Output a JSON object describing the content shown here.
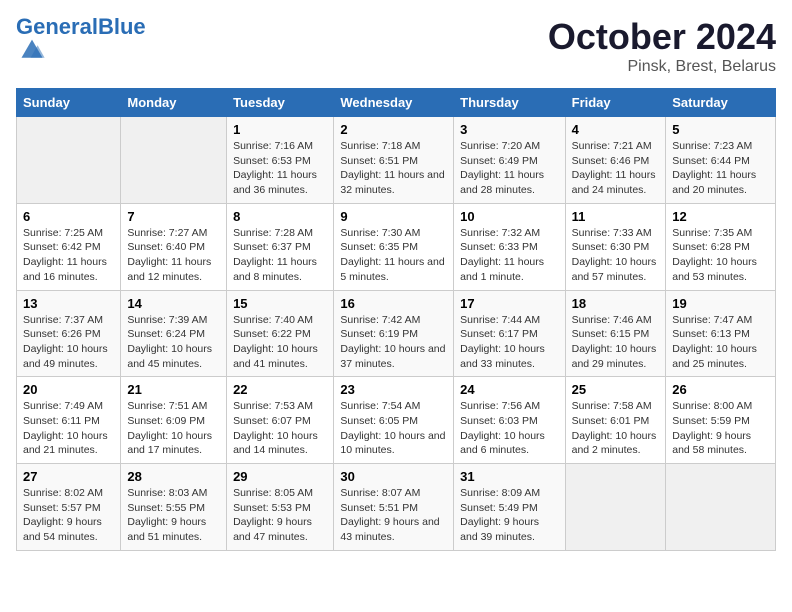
{
  "logo": {
    "text_general": "General",
    "text_blue": "Blue"
  },
  "title": "October 2024",
  "subtitle": "Pinsk, Brest, Belarus",
  "days_of_week": [
    "Sunday",
    "Monday",
    "Tuesday",
    "Wednesday",
    "Thursday",
    "Friday",
    "Saturday"
  ],
  "weeks": [
    [
      {
        "day": "",
        "info": ""
      },
      {
        "day": "",
        "info": ""
      },
      {
        "day": "1",
        "info": "Sunrise: 7:16 AM\nSunset: 6:53 PM\nDaylight: 11 hours and 36 minutes."
      },
      {
        "day": "2",
        "info": "Sunrise: 7:18 AM\nSunset: 6:51 PM\nDaylight: 11 hours and 32 minutes."
      },
      {
        "day": "3",
        "info": "Sunrise: 7:20 AM\nSunset: 6:49 PM\nDaylight: 11 hours and 28 minutes."
      },
      {
        "day": "4",
        "info": "Sunrise: 7:21 AM\nSunset: 6:46 PM\nDaylight: 11 hours and 24 minutes."
      },
      {
        "day": "5",
        "info": "Sunrise: 7:23 AM\nSunset: 6:44 PM\nDaylight: 11 hours and 20 minutes."
      }
    ],
    [
      {
        "day": "6",
        "info": "Sunrise: 7:25 AM\nSunset: 6:42 PM\nDaylight: 11 hours and 16 minutes."
      },
      {
        "day": "7",
        "info": "Sunrise: 7:27 AM\nSunset: 6:40 PM\nDaylight: 11 hours and 12 minutes."
      },
      {
        "day": "8",
        "info": "Sunrise: 7:28 AM\nSunset: 6:37 PM\nDaylight: 11 hours and 8 minutes."
      },
      {
        "day": "9",
        "info": "Sunrise: 7:30 AM\nSunset: 6:35 PM\nDaylight: 11 hours and 5 minutes."
      },
      {
        "day": "10",
        "info": "Sunrise: 7:32 AM\nSunset: 6:33 PM\nDaylight: 11 hours and 1 minute."
      },
      {
        "day": "11",
        "info": "Sunrise: 7:33 AM\nSunset: 6:30 PM\nDaylight: 10 hours and 57 minutes."
      },
      {
        "day": "12",
        "info": "Sunrise: 7:35 AM\nSunset: 6:28 PM\nDaylight: 10 hours and 53 minutes."
      }
    ],
    [
      {
        "day": "13",
        "info": "Sunrise: 7:37 AM\nSunset: 6:26 PM\nDaylight: 10 hours and 49 minutes."
      },
      {
        "day": "14",
        "info": "Sunrise: 7:39 AM\nSunset: 6:24 PM\nDaylight: 10 hours and 45 minutes."
      },
      {
        "day": "15",
        "info": "Sunrise: 7:40 AM\nSunset: 6:22 PM\nDaylight: 10 hours and 41 minutes."
      },
      {
        "day": "16",
        "info": "Sunrise: 7:42 AM\nSunset: 6:19 PM\nDaylight: 10 hours and 37 minutes."
      },
      {
        "day": "17",
        "info": "Sunrise: 7:44 AM\nSunset: 6:17 PM\nDaylight: 10 hours and 33 minutes."
      },
      {
        "day": "18",
        "info": "Sunrise: 7:46 AM\nSunset: 6:15 PM\nDaylight: 10 hours and 29 minutes."
      },
      {
        "day": "19",
        "info": "Sunrise: 7:47 AM\nSunset: 6:13 PM\nDaylight: 10 hours and 25 minutes."
      }
    ],
    [
      {
        "day": "20",
        "info": "Sunrise: 7:49 AM\nSunset: 6:11 PM\nDaylight: 10 hours and 21 minutes."
      },
      {
        "day": "21",
        "info": "Sunrise: 7:51 AM\nSunset: 6:09 PM\nDaylight: 10 hours and 17 minutes."
      },
      {
        "day": "22",
        "info": "Sunrise: 7:53 AM\nSunset: 6:07 PM\nDaylight: 10 hours and 14 minutes."
      },
      {
        "day": "23",
        "info": "Sunrise: 7:54 AM\nSunset: 6:05 PM\nDaylight: 10 hours and 10 minutes."
      },
      {
        "day": "24",
        "info": "Sunrise: 7:56 AM\nSunset: 6:03 PM\nDaylight: 10 hours and 6 minutes."
      },
      {
        "day": "25",
        "info": "Sunrise: 7:58 AM\nSunset: 6:01 PM\nDaylight: 10 hours and 2 minutes."
      },
      {
        "day": "26",
        "info": "Sunrise: 8:00 AM\nSunset: 5:59 PM\nDaylight: 9 hours and 58 minutes."
      }
    ],
    [
      {
        "day": "27",
        "info": "Sunrise: 8:02 AM\nSunset: 5:57 PM\nDaylight: 9 hours and 54 minutes."
      },
      {
        "day": "28",
        "info": "Sunrise: 8:03 AM\nSunset: 5:55 PM\nDaylight: 9 hours and 51 minutes."
      },
      {
        "day": "29",
        "info": "Sunrise: 8:05 AM\nSunset: 5:53 PM\nDaylight: 9 hours and 47 minutes."
      },
      {
        "day": "30",
        "info": "Sunrise: 8:07 AM\nSunset: 5:51 PM\nDaylight: 9 hours and 43 minutes."
      },
      {
        "day": "31",
        "info": "Sunrise: 8:09 AM\nSunset: 5:49 PM\nDaylight: 9 hours and 39 minutes."
      },
      {
        "day": "",
        "info": ""
      },
      {
        "day": "",
        "info": ""
      }
    ]
  ]
}
